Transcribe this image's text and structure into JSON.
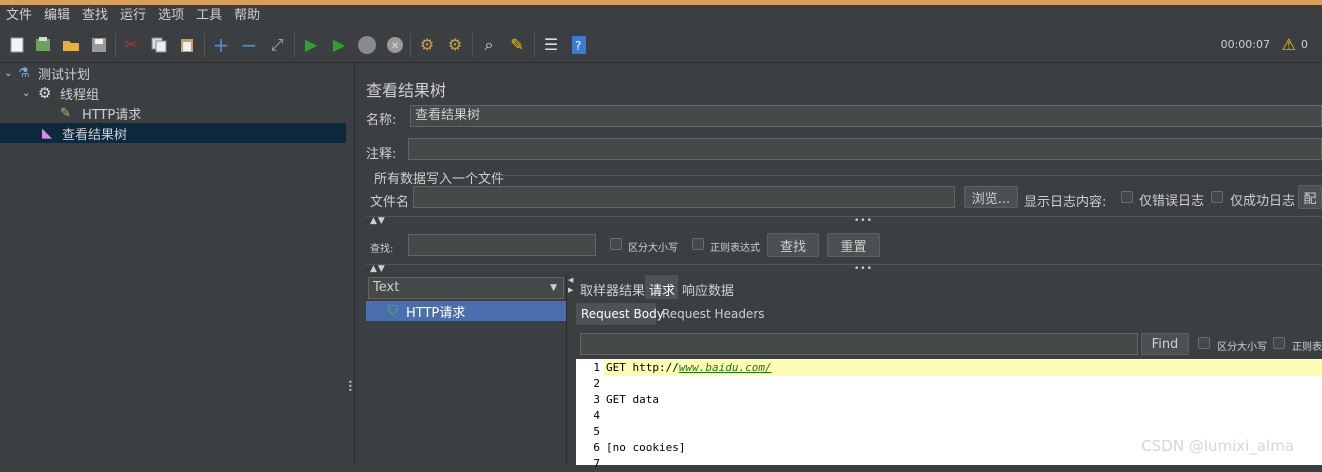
{
  "menu": [
    "文件",
    "编辑",
    "查找",
    "运行",
    "选项",
    "工具",
    "帮助"
  ],
  "toolbar": {
    "icons": [
      "new-icon",
      "templates-icon",
      "open-icon",
      "save-icon",
      "cut-icon",
      "copy-icon",
      "paste-icon",
      "expand-icon",
      "collapse-icon",
      "toggle-icon",
      "start-icon",
      "start-no-pause-icon",
      "stop-icon",
      "shutdown-icon",
      "clear-icon",
      "clear-all-icon",
      "search-icon",
      "reset-search-icon",
      "function-helper-icon",
      "help-icon"
    ],
    "timer": "00:00:07",
    "warning_count": "0"
  },
  "tree": {
    "items": [
      {
        "label": "测试计划",
        "icon": "test-plan-icon"
      },
      {
        "label": "线程组",
        "icon": "thread-group-icon"
      },
      {
        "label": "HTTP请求",
        "icon": "http-sampler-icon"
      },
      {
        "label": "查看结果树",
        "icon": "results-tree-icon"
      }
    ]
  },
  "panel": {
    "title": "查看结果树",
    "name_label": "名称:",
    "name_value": "查看结果树",
    "comment_label": "注释:",
    "comment_value": "",
    "file_group_title": "所有数据写入一个文件",
    "file_label": "文件名",
    "file_value": "",
    "browse_label": "浏览...",
    "log_label": "显示日志内容:",
    "errors_only": "仅错误日志",
    "success_only": "仅成功日志",
    "config_label": "配",
    "search_label": "查找:",
    "search_value": "",
    "case_label": "区分大小写",
    "regex_label": "正则表达式",
    "find_btn": "查找",
    "reset_btn": "重置"
  },
  "results": {
    "renderer": "Text",
    "sample": "HTTP请求",
    "tabs": [
      "取样器结果",
      "请求",
      "响应数据"
    ],
    "active_tab": "请求",
    "subtabs": [
      "Request Body",
      "Request Headers"
    ],
    "find_label": "Find",
    "find_value": "",
    "case_label": "区分大小写",
    "regex_label": "正则表",
    "lines": [
      {
        "n": "1",
        "prefix": "GET http://",
        "link": "www.baidu.com/"
      },
      {
        "n": "2",
        "text": ""
      },
      {
        "n": "3",
        "text": "GET data"
      },
      {
        "n": "4",
        "text": ""
      },
      {
        "n": "5",
        "text": ""
      },
      {
        "n": "6",
        "text": "[no cookies]"
      },
      {
        "n": "7",
        "text": ""
      }
    ]
  },
  "watermark": "CSDN @lumixi_alma"
}
